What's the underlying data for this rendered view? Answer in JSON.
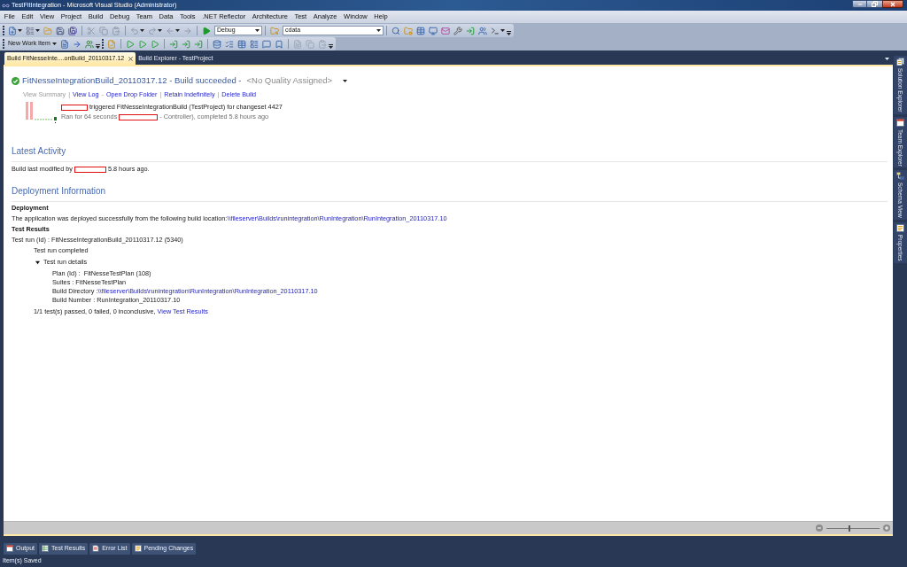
{
  "window": {
    "title": "TestFitIntegration - Microsoft Visual Studio (Administrator)"
  },
  "menu": [
    {
      "label": "File"
    },
    {
      "label": "Edit"
    },
    {
      "label": "View"
    },
    {
      "label": "Project"
    },
    {
      "label": "Build"
    },
    {
      "label": "Debug"
    },
    {
      "label": "Team"
    },
    {
      "label": "Data"
    },
    {
      "label": "Tools"
    },
    {
      "label": ".NET Reflector"
    },
    {
      "label": "Architecture"
    },
    {
      "label": "Test"
    },
    {
      "label": "Analyze"
    },
    {
      "label": "Window"
    },
    {
      "label": "Help"
    }
  ],
  "toolbar": {
    "configuration": "Debug",
    "search_combo": "cdata",
    "new_work_item": "New Work Item"
  },
  "document_tabs": [
    {
      "label": "Build FitNesseInte....onBuild_20110317.12",
      "selected": true
    },
    {
      "label": "Build Explorer - TestProject",
      "selected": false
    }
  ],
  "build": {
    "title": "FitNesseIntegrationBuild_20110317.12 - Build succeeded -",
    "quality": "<No Quality Assigned>",
    "actions": [
      {
        "label": "View Summary",
        "disabled": true
      },
      {
        "separator": "|",
        "label": "View Log",
        "disabled": false
      },
      {
        "separator": "-",
        "label": "Open Drop Folder",
        "disabled": false
      },
      {
        "separator": "|",
        "label": "Retain Indefinitely",
        "disabled": false
      },
      {
        "separator": "|",
        "label": "Delete Build",
        "disabled": false
      }
    ],
    "trigger": "triggered FitNesseIntegrationBuild (TestProject) for changeset 4427",
    "run_start": "Ran for 64 seconds",
    "run_end": "- Controller), completed 5.8 hours ago"
  },
  "latest_activity": {
    "heading": "Latest Activity",
    "text_start": "Build last modified by",
    "text_end": "5.8 hours ago."
  },
  "deployment_information": {
    "heading": "Deployment Information",
    "deployment": {
      "heading": "Deployment",
      "text": "The application was deployed successfully from the following build location:",
      "link": "\\\\fileserver\\Builds\\runintegration\\RunIntegration\\RunIntegration_20110317.10"
    },
    "test_results": {
      "heading": "Test Results",
      "run": "Test run (Id) : FitNesseIntegrationBuild_20110317.12 (5340)",
      "children": [
        {
          "label": "Test run completed"
        },
        {
          "label": "Test run details",
          "expanded": true,
          "children": [
            {
              "label": "Plan (Id) :  FitNesseTestPlan (108)"
            },
            {
              "label": "Suites : FitNesseTestPlan"
            },
            {
              "label": "Build Directory :",
              "link": "\\\\fileserver\\Builds\\runintegration\\RunIntegration\\RunIntegration_20110317.10"
            },
            {
              "label": "Build Number : RunIntegration_20110317.10"
            }
          ]
        }
      ],
      "summary": "1/1 test(s) passed, 0 failed, 0 inconclusive,",
      "summary_link": "View Test Results"
    }
  },
  "zoom": {
    "level": 0.42
  },
  "side_tabs": [
    {
      "label": "Solution Explorer"
    },
    {
      "label": "Team Explorer"
    },
    {
      "label": "Schema View"
    },
    {
      "label": "Properties"
    }
  ],
  "tool_tabs": [
    {
      "label": "Output"
    },
    {
      "label": "Test Results"
    },
    {
      "label": "Error List"
    },
    {
      "label": "Pending Changes"
    }
  ],
  "status_bar": {
    "text": "Item(s) Saved"
  }
}
